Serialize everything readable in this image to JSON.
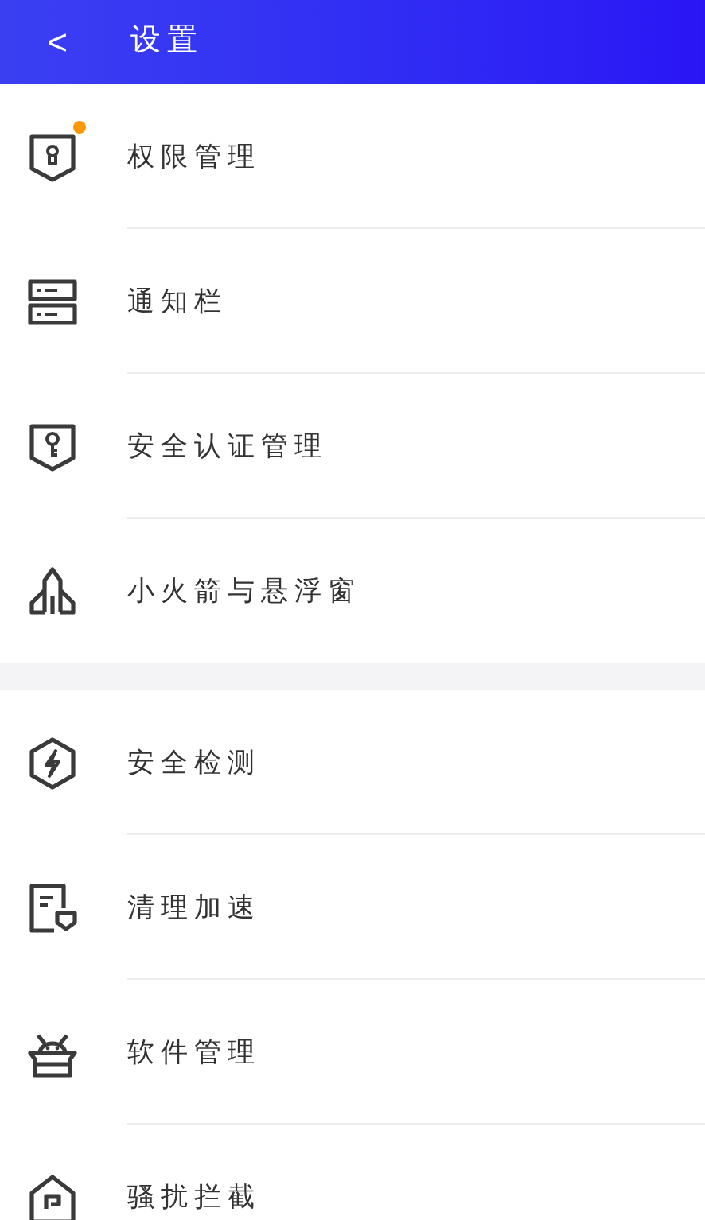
{
  "header": {
    "back": "<",
    "title": "设置"
  },
  "groups": [
    {
      "items": [
        {
          "kind": "shield-lock",
          "label": "权限管理",
          "dot": true
        },
        {
          "kind": "stack",
          "label": "通知栏",
          "dot": false
        },
        {
          "kind": "shield-key",
          "label": "安全认证管理",
          "dot": false
        },
        {
          "kind": "rocket",
          "label": "小火箭与悬浮窗",
          "dot": false
        }
      ]
    },
    {
      "items": [
        {
          "kind": "hex-bolt",
          "label": "安全检测",
          "dot": false
        },
        {
          "kind": "doc-shield",
          "label": "清理加速",
          "dot": false
        },
        {
          "kind": "robot",
          "label": "软件管理",
          "dot": false
        },
        {
          "kind": "house",
          "label": "骚扰拦截",
          "dot": false
        }
      ]
    }
  ]
}
